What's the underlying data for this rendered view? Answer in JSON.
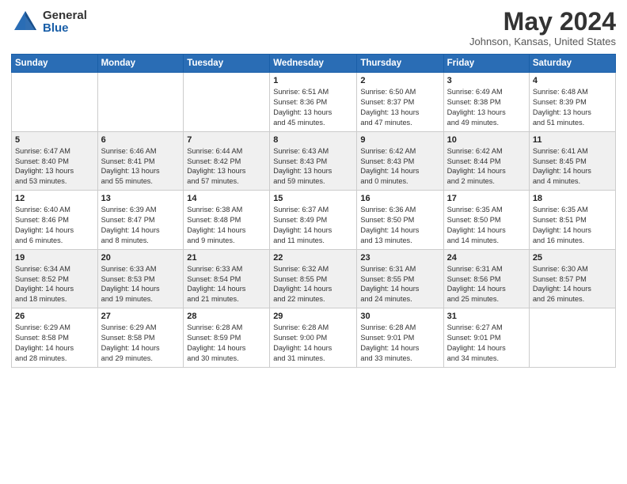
{
  "logo": {
    "general": "General",
    "blue": "Blue"
  },
  "title": "May 2024",
  "subtitle": "Johnson, Kansas, United States",
  "days_of_week": [
    "Sunday",
    "Monday",
    "Tuesday",
    "Wednesday",
    "Thursday",
    "Friday",
    "Saturday"
  ],
  "weeks": [
    [
      {
        "day": "",
        "info": ""
      },
      {
        "day": "",
        "info": ""
      },
      {
        "day": "",
        "info": ""
      },
      {
        "day": "1",
        "info": "Sunrise: 6:51 AM\nSunset: 8:36 PM\nDaylight: 13 hours\nand 45 minutes."
      },
      {
        "day": "2",
        "info": "Sunrise: 6:50 AM\nSunset: 8:37 PM\nDaylight: 13 hours\nand 47 minutes."
      },
      {
        "day": "3",
        "info": "Sunrise: 6:49 AM\nSunset: 8:38 PM\nDaylight: 13 hours\nand 49 minutes."
      },
      {
        "day": "4",
        "info": "Sunrise: 6:48 AM\nSunset: 8:39 PM\nDaylight: 13 hours\nand 51 minutes."
      }
    ],
    [
      {
        "day": "5",
        "info": "Sunrise: 6:47 AM\nSunset: 8:40 PM\nDaylight: 13 hours\nand 53 minutes."
      },
      {
        "day": "6",
        "info": "Sunrise: 6:46 AM\nSunset: 8:41 PM\nDaylight: 13 hours\nand 55 minutes."
      },
      {
        "day": "7",
        "info": "Sunrise: 6:44 AM\nSunset: 8:42 PM\nDaylight: 13 hours\nand 57 minutes."
      },
      {
        "day": "8",
        "info": "Sunrise: 6:43 AM\nSunset: 8:43 PM\nDaylight: 13 hours\nand 59 minutes."
      },
      {
        "day": "9",
        "info": "Sunrise: 6:42 AM\nSunset: 8:43 PM\nDaylight: 14 hours\nand 0 minutes."
      },
      {
        "day": "10",
        "info": "Sunrise: 6:42 AM\nSunset: 8:44 PM\nDaylight: 14 hours\nand 2 minutes."
      },
      {
        "day": "11",
        "info": "Sunrise: 6:41 AM\nSunset: 8:45 PM\nDaylight: 14 hours\nand 4 minutes."
      }
    ],
    [
      {
        "day": "12",
        "info": "Sunrise: 6:40 AM\nSunset: 8:46 PM\nDaylight: 14 hours\nand 6 minutes."
      },
      {
        "day": "13",
        "info": "Sunrise: 6:39 AM\nSunset: 8:47 PM\nDaylight: 14 hours\nand 8 minutes."
      },
      {
        "day": "14",
        "info": "Sunrise: 6:38 AM\nSunset: 8:48 PM\nDaylight: 14 hours\nand 9 minutes."
      },
      {
        "day": "15",
        "info": "Sunrise: 6:37 AM\nSunset: 8:49 PM\nDaylight: 14 hours\nand 11 minutes."
      },
      {
        "day": "16",
        "info": "Sunrise: 6:36 AM\nSunset: 8:50 PM\nDaylight: 14 hours\nand 13 minutes."
      },
      {
        "day": "17",
        "info": "Sunrise: 6:35 AM\nSunset: 8:50 PM\nDaylight: 14 hours\nand 14 minutes."
      },
      {
        "day": "18",
        "info": "Sunrise: 6:35 AM\nSunset: 8:51 PM\nDaylight: 14 hours\nand 16 minutes."
      }
    ],
    [
      {
        "day": "19",
        "info": "Sunrise: 6:34 AM\nSunset: 8:52 PM\nDaylight: 14 hours\nand 18 minutes."
      },
      {
        "day": "20",
        "info": "Sunrise: 6:33 AM\nSunset: 8:53 PM\nDaylight: 14 hours\nand 19 minutes."
      },
      {
        "day": "21",
        "info": "Sunrise: 6:33 AM\nSunset: 8:54 PM\nDaylight: 14 hours\nand 21 minutes."
      },
      {
        "day": "22",
        "info": "Sunrise: 6:32 AM\nSunset: 8:55 PM\nDaylight: 14 hours\nand 22 minutes."
      },
      {
        "day": "23",
        "info": "Sunrise: 6:31 AM\nSunset: 8:55 PM\nDaylight: 14 hours\nand 24 minutes."
      },
      {
        "day": "24",
        "info": "Sunrise: 6:31 AM\nSunset: 8:56 PM\nDaylight: 14 hours\nand 25 minutes."
      },
      {
        "day": "25",
        "info": "Sunrise: 6:30 AM\nSunset: 8:57 PM\nDaylight: 14 hours\nand 26 minutes."
      }
    ],
    [
      {
        "day": "26",
        "info": "Sunrise: 6:29 AM\nSunset: 8:58 PM\nDaylight: 14 hours\nand 28 minutes."
      },
      {
        "day": "27",
        "info": "Sunrise: 6:29 AM\nSunset: 8:58 PM\nDaylight: 14 hours\nand 29 minutes."
      },
      {
        "day": "28",
        "info": "Sunrise: 6:28 AM\nSunset: 8:59 PM\nDaylight: 14 hours\nand 30 minutes."
      },
      {
        "day": "29",
        "info": "Sunrise: 6:28 AM\nSunset: 9:00 PM\nDaylight: 14 hours\nand 31 minutes."
      },
      {
        "day": "30",
        "info": "Sunrise: 6:28 AM\nSunset: 9:01 PM\nDaylight: 14 hours\nand 33 minutes."
      },
      {
        "day": "31",
        "info": "Sunrise: 6:27 AM\nSunset: 9:01 PM\nDaylight: 14 hours\nand 34 minutes."
      },
      {
        "day": "",
        "info": ""
      }
    ]
  ]
}
